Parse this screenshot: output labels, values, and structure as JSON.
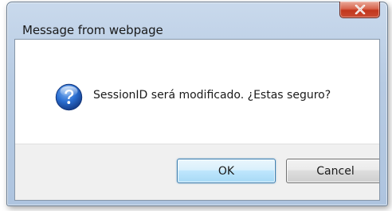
{
  "dialog": {
    "title": "Message from webpage",
    "message": "SessionID será modificado. ¿Estas seguro?",
    "icon": "question-icon",
    "buttons": {
      "ok_label": "OK",
      "cancel_label": "Cancel"
    },
    "colors": {
      "close_button": "#c94b31",
      "icon_blue": "#1f5fbf",
      "default_button_border": "#3c7fb1"
    }
  }
}
